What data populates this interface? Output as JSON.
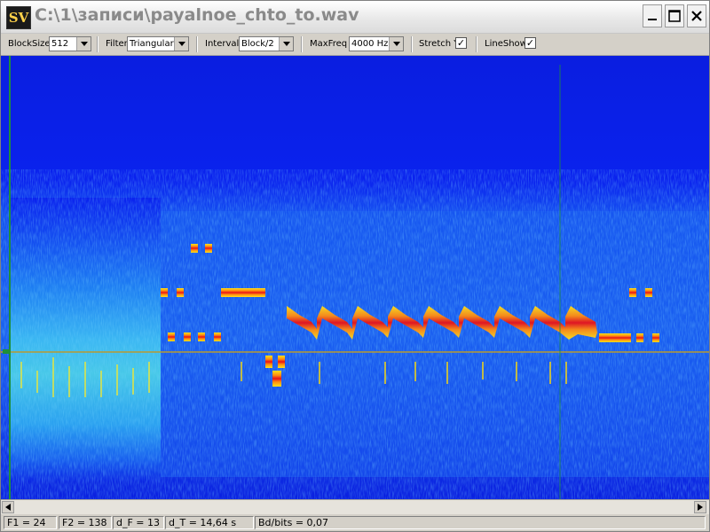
{
  "window": {
    "icon_text": "SV",
    "title": "C:\\1\\записи\\payalnoe_chto_to.wav"
  },
  "toolbar": {
    "blocksize_label": "BlockSize",
    "blocksize_value": "512",
    "filter_label": "Filter",
    "filter_value": "Triangular",
    "interval_label": "Interval",
    "interval_value": "Block/2",
    "maxfreq_label": "MaxFreq",
    "maxfreq_value": "4000 Hz",
    "stretchy_label": "Stretch Y",
    "stretchy_checked": "✓",
    "lineshow_label": "LineShow",
    "lineshow_checked": "✓"
  },
  "status": {
    "f1": "F1 = 24",
    "f2": "F2 = 138",
    "df": "d_F = 13",
    "dt": "d_T = 14,64 s",
    "bdbits": "Bd/bits = 0,07"
  },
  "colors": {
    "background_blue": "#0a20e8",
    "noise_cyan": "#2aa0f0",
    "signal_yellow": "#ffe21a",
    "signal_red": "#e8101a"
  }
}
